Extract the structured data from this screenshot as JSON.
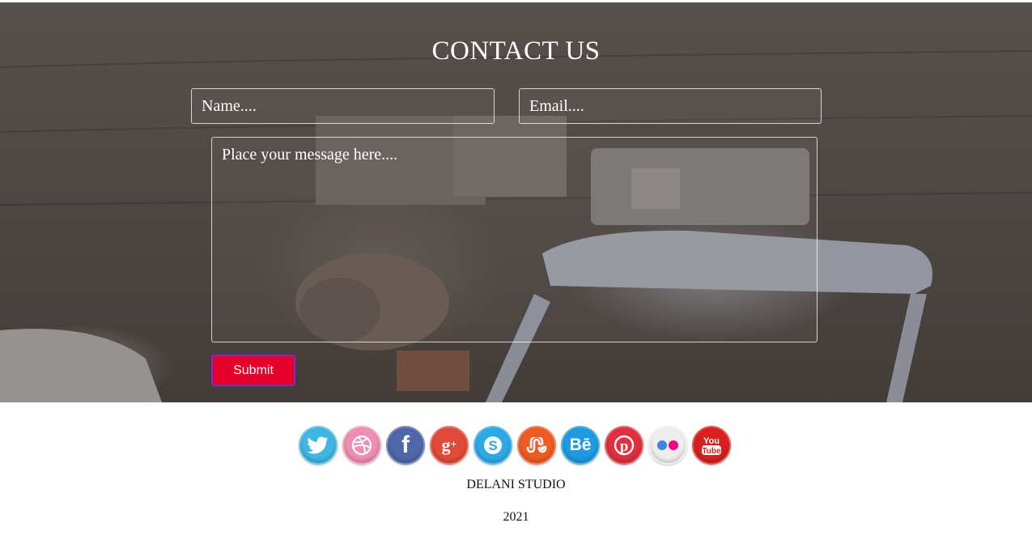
{
  "contact": {
    "title": "CONTACT US",
    "name_placeholder": "Name....",
    "email_placeholder": "Email....",
    "message_placeholder": "Place your message here....",
    "submit_label": "Submit"
  },
  "social": [
    {
      "name": "twitter-icon",
      "color": "#3fb7e3"
    },
    {
      "name": "dribbble-icon",
      "color": "#ee8eb3"
    },
    {
      "name": "facebook-icon",
      "color": "#4f67a8"
    },
    {
      "name": "google-plus-icon",
      "color": "#df4b38"
    },
    {
      "name": "skype-icon",
      "color": "#2fa8e6"
    },
    {
      "name": "stumbleupon-icon",
      "color": "#ee5b23"
    },
    {
      "name": "behance-icon",
      "color": "#1f9ae0"
    },
    {
      "name": "pinterest-icon",
      "color": "#e0303f"
    },
    {
      "name": "flickr-icon",
      "color": "#eeeeee"
    },
    {
      "name": "youtube-icon",
      "color": "#d9201f"
    }
  ],
  "footer": {
    "studio": "DELANI STUDIO",
    "year": "2021"
  }
}
